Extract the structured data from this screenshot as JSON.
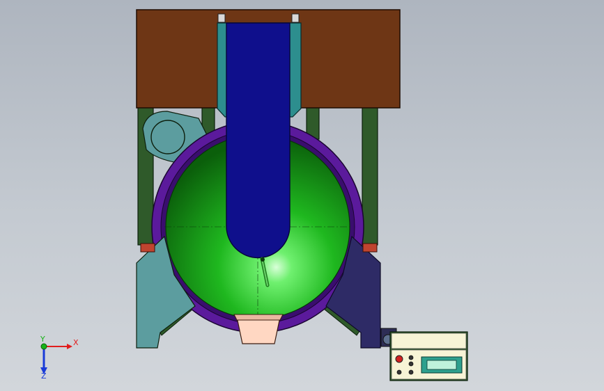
{
  "viewport": {
    "background_top": "#aeb5bf",
    "background_bottom": "#d2d6db"
  },
  "model": {
    "colors": {
      "top_plate": "#6e3615",
      "frame_rails": "#2f5a2a",
      "cover_teal": "#2d8e8e",
      "stirrer_blue": "#0f0f8c",
      "bowl_rim": "#5b1a9c",
      "bowl_inner": "#1fb81f",
      "left_support": "#5c9d9f",
      "right_support": "#2e2b66",
      "outlet_chute": "#ffd7c2",
      "bracket_red": "#c0442f"
    }
  },
  "control_box": {
    "panel_color": "#f7f4d6",
    "body_color": "#2f5a2a",
    "display_color": "#2ea08e"
  },
  "triad": {
    "x_label": "X",
    "y_label": "Y",
    "z_label": "Z",
    "x_color": "#e11d1d",
    "y_color": "#17b317",
    "z_color": "#1a3bd8"
  }
}
